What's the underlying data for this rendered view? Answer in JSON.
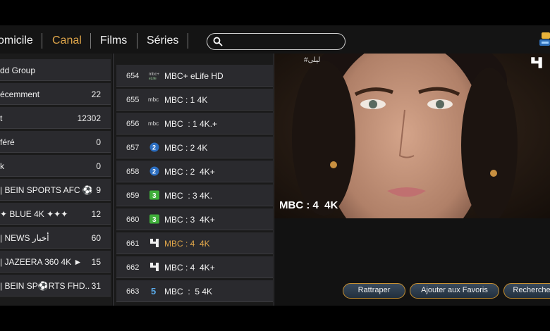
{
  "nav": {
    "items": [
      {
        "label": "omicile",
        "active": false
      },
      {
        "label": "Canal",
        "active": true
      },
      {
        "label": "Films",
        "active": false
      },
      {
        "label": "Séries",
        "active": false
      }
    ],
    "search": {
      "placeholder": "",
      "value": ""
    },
    "icons": {
      "search": "search-icon",
      "corner_logo": "app-logo"
    }
  },
  "groups": [
    {
      "label": "dd Group",
      "count": ""
    },
    {
      "label": "écemment",
      "count": "22"
    },
    {
      "label": "t",
      "count": "12302"
    },
    {
      "label": "féré",
      "count": "0"
    },
    {
      "label": "k",
      "count": "0"
    },
    {
      "label": "| BEIN SPORTS AFC ⚽",
      "count": "9"
    },
    {
      "label": "✦ BLUE 4K ✦✦✦",
      "count": "12"
    },
    {
      "label": "| NEWS أخبار",
      "count": "60"
    },
    {
      "label": "| JAZEERA 360 4K ►",
      "count": "15"
    },
    {
      "label": "| BEIN SP⚽RTS FHD..",
      "count": "31"
    }
  ],
  "channels": [
    {
      "number": "654",
      "name": "MBC+ eLife HD",
      "logo": "mbc-plus-elife-logo",
      "active": false
    },
    {
      "number": "655",
      "name": "MBC : 1 4K",
      "logo": "mbc-logo",
      "active": false
    },
    {
      "number": "656",
      "name": "MBC  : 1 4K.+",
      "logo": "mbc-logo",
      "active": false
    },
    {
      "number": "657",
      "name": "MBC : 2 4K",
      "logo": "mbc2-logo",
      "active": false
    },
    {
      "number": "658",
      "name": "MBC : 2  4K+",
      "logo": "mbc2-logo",
      "active": false
    },
    {
      "number": "659",
      "name": "MBC  : 3 4K.",
      "logo": "mbc3-logo",
      "active": false
    },
    {
      "number": "660",
      "name": "MBC : 3  4K+",
      "logo": "mbc3-logo",
      "active": false
    },
    {
      "number": "661",
      "name": "MBC : 4  4K",
      "logo": "mbc4-logo",
      "active": true
    },
    {
      "number": "662",
      "name": "MBC : 4  4K+",
      "logo": "mbc4-logo",
      "active": false
    },
    {
      "number": "663",
      "name": "MBC  :  5 4K",
      "logo": "mbc5-logo",
      "active": false
    }
  ],
  "preview": {
    "title": "MBC : 4  4K",
    "overlay_text": "#ليلى",
    "icons": {
      "channel_logo": "mbc4-logo"
    }
  },
  "actions": [
    {
      "label": "Rattraper"
    },
    {
      "label": "Ajouter aux Favoris"
    },
    {
      "label": "Recherche"
    }
  ],
  "colors": {
    "accent": "#e0a64a",
    "row_bg": "#2a2a2e",
    "button_border": "#c89030",
    "button_bg": "#2e3c4c"
  }
}
